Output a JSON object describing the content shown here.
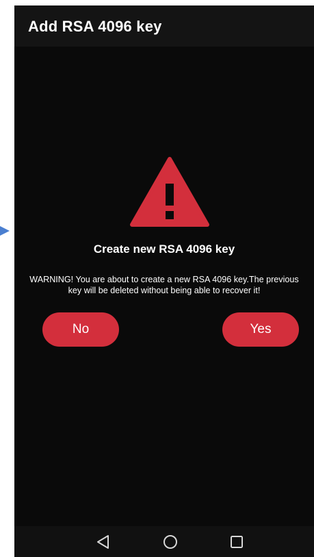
{
  "appbar": {
    "title": "Add RSA 4096 key"
  },
  "dialog": {
    "icon": "warning-triangle-icon",
    "title": "Create new RSA 4096 key",
    "message": "WARNING! You are about to create a new RSA 4096 key.The previous key will be deleted without being able to recover it!",
    "no_label": "No",
    "yes_label": "Yes"
  },
  "navbar": {
    "back_icon": "back-triangle-icon",
    "home_icon": "home-circle-icon",
    "recent_icon": "recent-apps-square-icon"
  },
  "colors": {
    "accent": "#d32f3c",
    "background": "#0a0a0a",
    "appbar": "#141414",
    "text": "#ffffff"
  }
}
